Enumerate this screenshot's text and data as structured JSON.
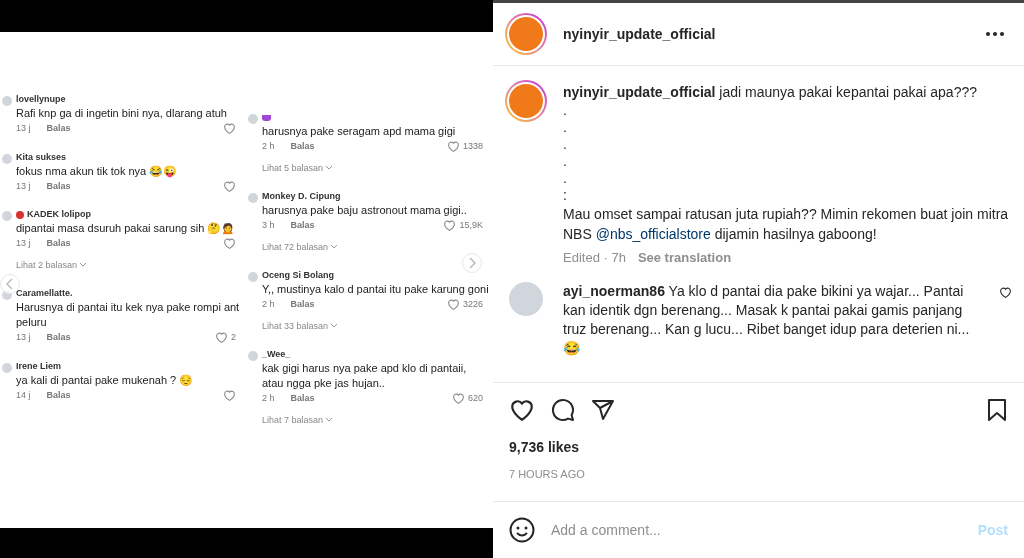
{
  "post_image": {
    "left_comments": [
      {
        "name": "lovellynupe",
        "kind": "plain",
        "text": "Rafi knp ga di ingetin bini nya, dlarang atuh",
        "time": "13 j",
        "reply": "Balas"
      },
      {
        "name": "Kita sukses",
        "kind": "plain",
        "text": "fokus nma akun tik tok nya 😂😜",
        "time": "13 j",
        "reply": "Balas"
      },
      {
        "name": "KADEK lolipop",
        "kind": "apple",
        "text": "dipantai masa dsuruh pakai sarung sih 🤔🙍",
        "time": "13 j",
        "reply": "Balas",
        "replies": "Lihat 2 balasan"
      },
      {
        "name": "Caramellatte.",
        "kind": "plain",
        "text": "Harusnya di pantai itu kek nya pake rompi ant peluru",
        "time": "13 j",
        "reply": "Balas",
        "likes": "2"
      },
      {
        "name": "Irene Liem",
        "kind": "plain",
        "text": "ya kali di pantai pake mukenah ? 😔",
        "time": "14 j",
        "reply": "Balas"
      }
    ],
    "right_comments": [
      {
        "kind": "purple",
        "text": "harusnya pake seragam apd mama gigi",
        "time": "2 h",
        "reply": "Balas",
        "likes": "1338",
        "replies": "Lihat 5 balasan"
      },
      {
        "name": "Monkey D. Cipung",
        "kind": "plain",
        "text": "harusnya pake baju astronout mama gigi..",
        "time": "3 h",
        "reply": "Balas",
        "likes": "15,9K",
        "replies": "Lihat 72 balasan"
      },
      {
        "name": "Oceng Si Bolang",
        "kind": "plain",
        "text": "Y,, mustinya kalo d pantai itu pake karung goni",
        "time": "2 h",
        "reply": "Balas",
        "likes": "3226",
        "replies": "Lihat 33 balasan"
      },
      {
        "name": "_Wee_",
        "kind": "plain",
        "text": "kak gigi harus nya pake apd klo di pantaii, atau ngga pke jas hujan..",
        "time": "2 h",
        "reply": "Balas",
        "likes": "620",
        "replies": "Lihat 7 balasan"
      }
    ]
  },
  "header": {
    "username": "nyinyir_update_official"
  },
  "caption": {
    "username": "nyinyir_update_official",
    "text": "jadi maunya pakai kepantai pakai apa???",
    "dots": [
      ".",
      ".",
      ".",
      ".",
      ".",
      ":"
    ],
    "promo": "Mau omset sampai ratusan juta rupiah?? Mimin rekomen buat join mitra NBS",
    "mention": "@nbs_officialstore",
    "promo_end": "dijamin hasilnya gaboong!",
    "edited": "Edited · 7h",
    "translate": "See translation"
  },
  "comments": [
    {
      "username": "ayi_noerman86",
      "text": "Ya klo d pantai dia pake bikini ya wajar... Pantai kan identik dgn berenang... Masak k pantai pakai gamis panjang truz berenang... Kan g lucu... Ribet banget idup para deterien ni...😂",
      "liked": false
    }
  ],
  "actions": {
    "liked": false,
    "saved": false
  },
  "likes": "9,736 likes",
  "time": "7 HOURS AGO",
  "add_comment": {
    "placeholder": "Add a comment...",
    "post": "Post"
  }
}
